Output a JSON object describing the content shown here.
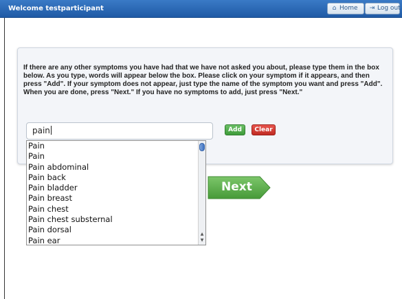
{
  "header": {
    "welcome_text": "Welcome testparticipant",
    "home_label": "Home",
    "logout_label": "Log out",
    "home_icon": "home-icon",
    "logout_icon": "logout-icon"
  },
  "instructions": "If there are any other symptoms you have had that we have not asked you about, please type them in the box below. As you type, words will appear below the box. Please click on your symptom if it appears, and then press \"Add\". If your symptom does not appear, just type the name of the symptom you want and press \"Add\". When you are done, press \"Next.\" If you have no symptoms to add, just press \"Next.\"",
  "symptom_input": {
    "value": "pain",
    "placeholder": ""
  },
  "buttons": {
    "add": "Add",
    "clear": "Clear",
    "next": "Next"
  },
  "suggestions": [
    "Pain",
    "Pain",
    "Pain abdominal",
    "Pain back",
    "Pain bladder",
    "Pain breast",
    "Pain chest",
    "Pain chest substernal",
    "Pain dorsal",
    "Pain ear"
  ],
  "colors": {
    "header_blue": "#2a66b3",
    "add_green": "#4fad4a",
    "clear_red": "#d43d35",
    "next_green": "#5ab04a"
  }
}
